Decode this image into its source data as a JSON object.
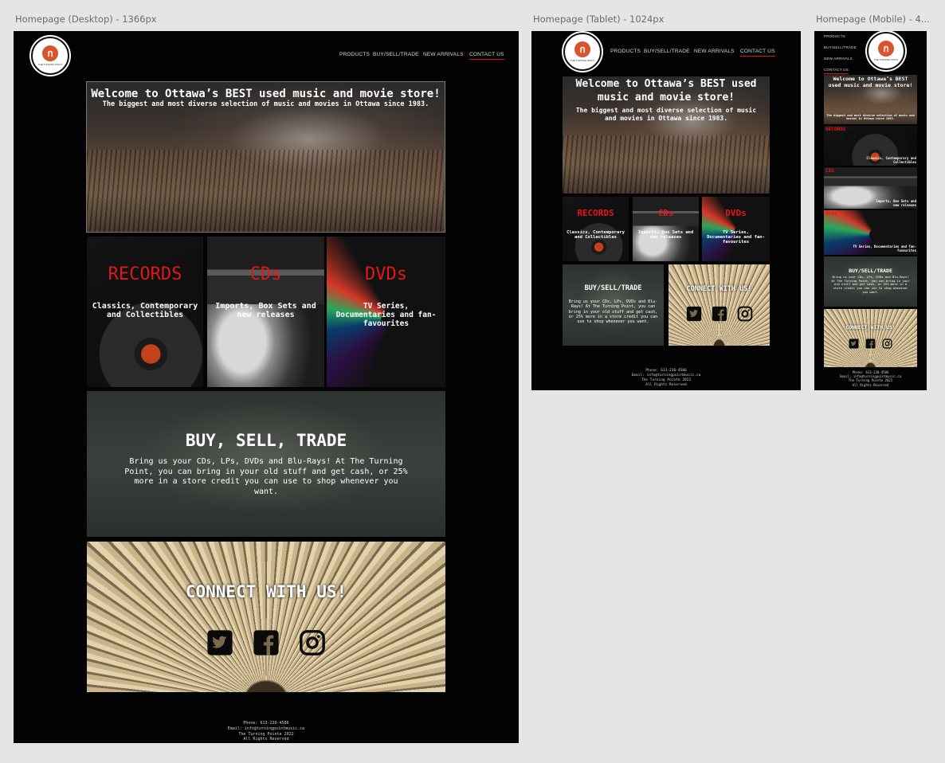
{
  "frames": {
    "desktop_label": "Homepage (Desktop) - 1366px",
    "tablet_label": "Homepage (Tablet) - 1024px",
    "mobile_label": "Homepage (Mobile) - 4..."
  },
  "brand": {
    "logo_mark": "ก",
    "logo_text": "THE TURNING POINT"
  },
  "nav": {
    "products": "PRODUCTS",
    "buy_sell_trade": "BUY/SELL/TRADE",
    "new_arrivals": "NEW ARRIVALS",
    "contact": "CONTACT US"
  },
  "hero": {
    "title": "Welcome to Ottawa’s BEST used music and movie store!",
    "subtitle": "The biggest and most diverse selection of music and movies in Ottawa since 1983."
  },
  "categories": {
    "records_title": "RECORDS",
    "records_desc": "Classics, Contemporary and Collectibles",
    "cds_title": "CDs",
    "cds_desc": "Imports, Box Sets and new releases",
    "dvds_title": "DVDs",
    "dvds_desc": "TV Series, Documentaries and fan-favourites"
  },
  "trade": {
    "title_desktop": "BUY, SELL, TRADE",
    "title_small": "BUY/SELL/TRADE",
    "body": "Bring us your CDs, LPs, DVDs and Blu-Rays!  At The Turning Point, you can bring in your old stuff and get cash, or 25% more in a store credit you can use to shop whenever you want."
  },
  "connect": {
    "title": "CONNECT WITH US!",
    "icons": [
      "twitter-icon",
      "facebook-icon",
      "instagram-icon"
    ]
  },
  "footer": {
    "phone": "Phone: 613-230-4586",
    "email": "Email: info@turningpointmusic.ca",
    "copyright": "The Turning Pointe 2022",
    "rights": "All Rights Reserved"
  },
  "colors": {
    "accent_red": "#e21818",
    "frame_bg": "#030303",
    "canvas_bg": "#e5e5e5"
  }
}
